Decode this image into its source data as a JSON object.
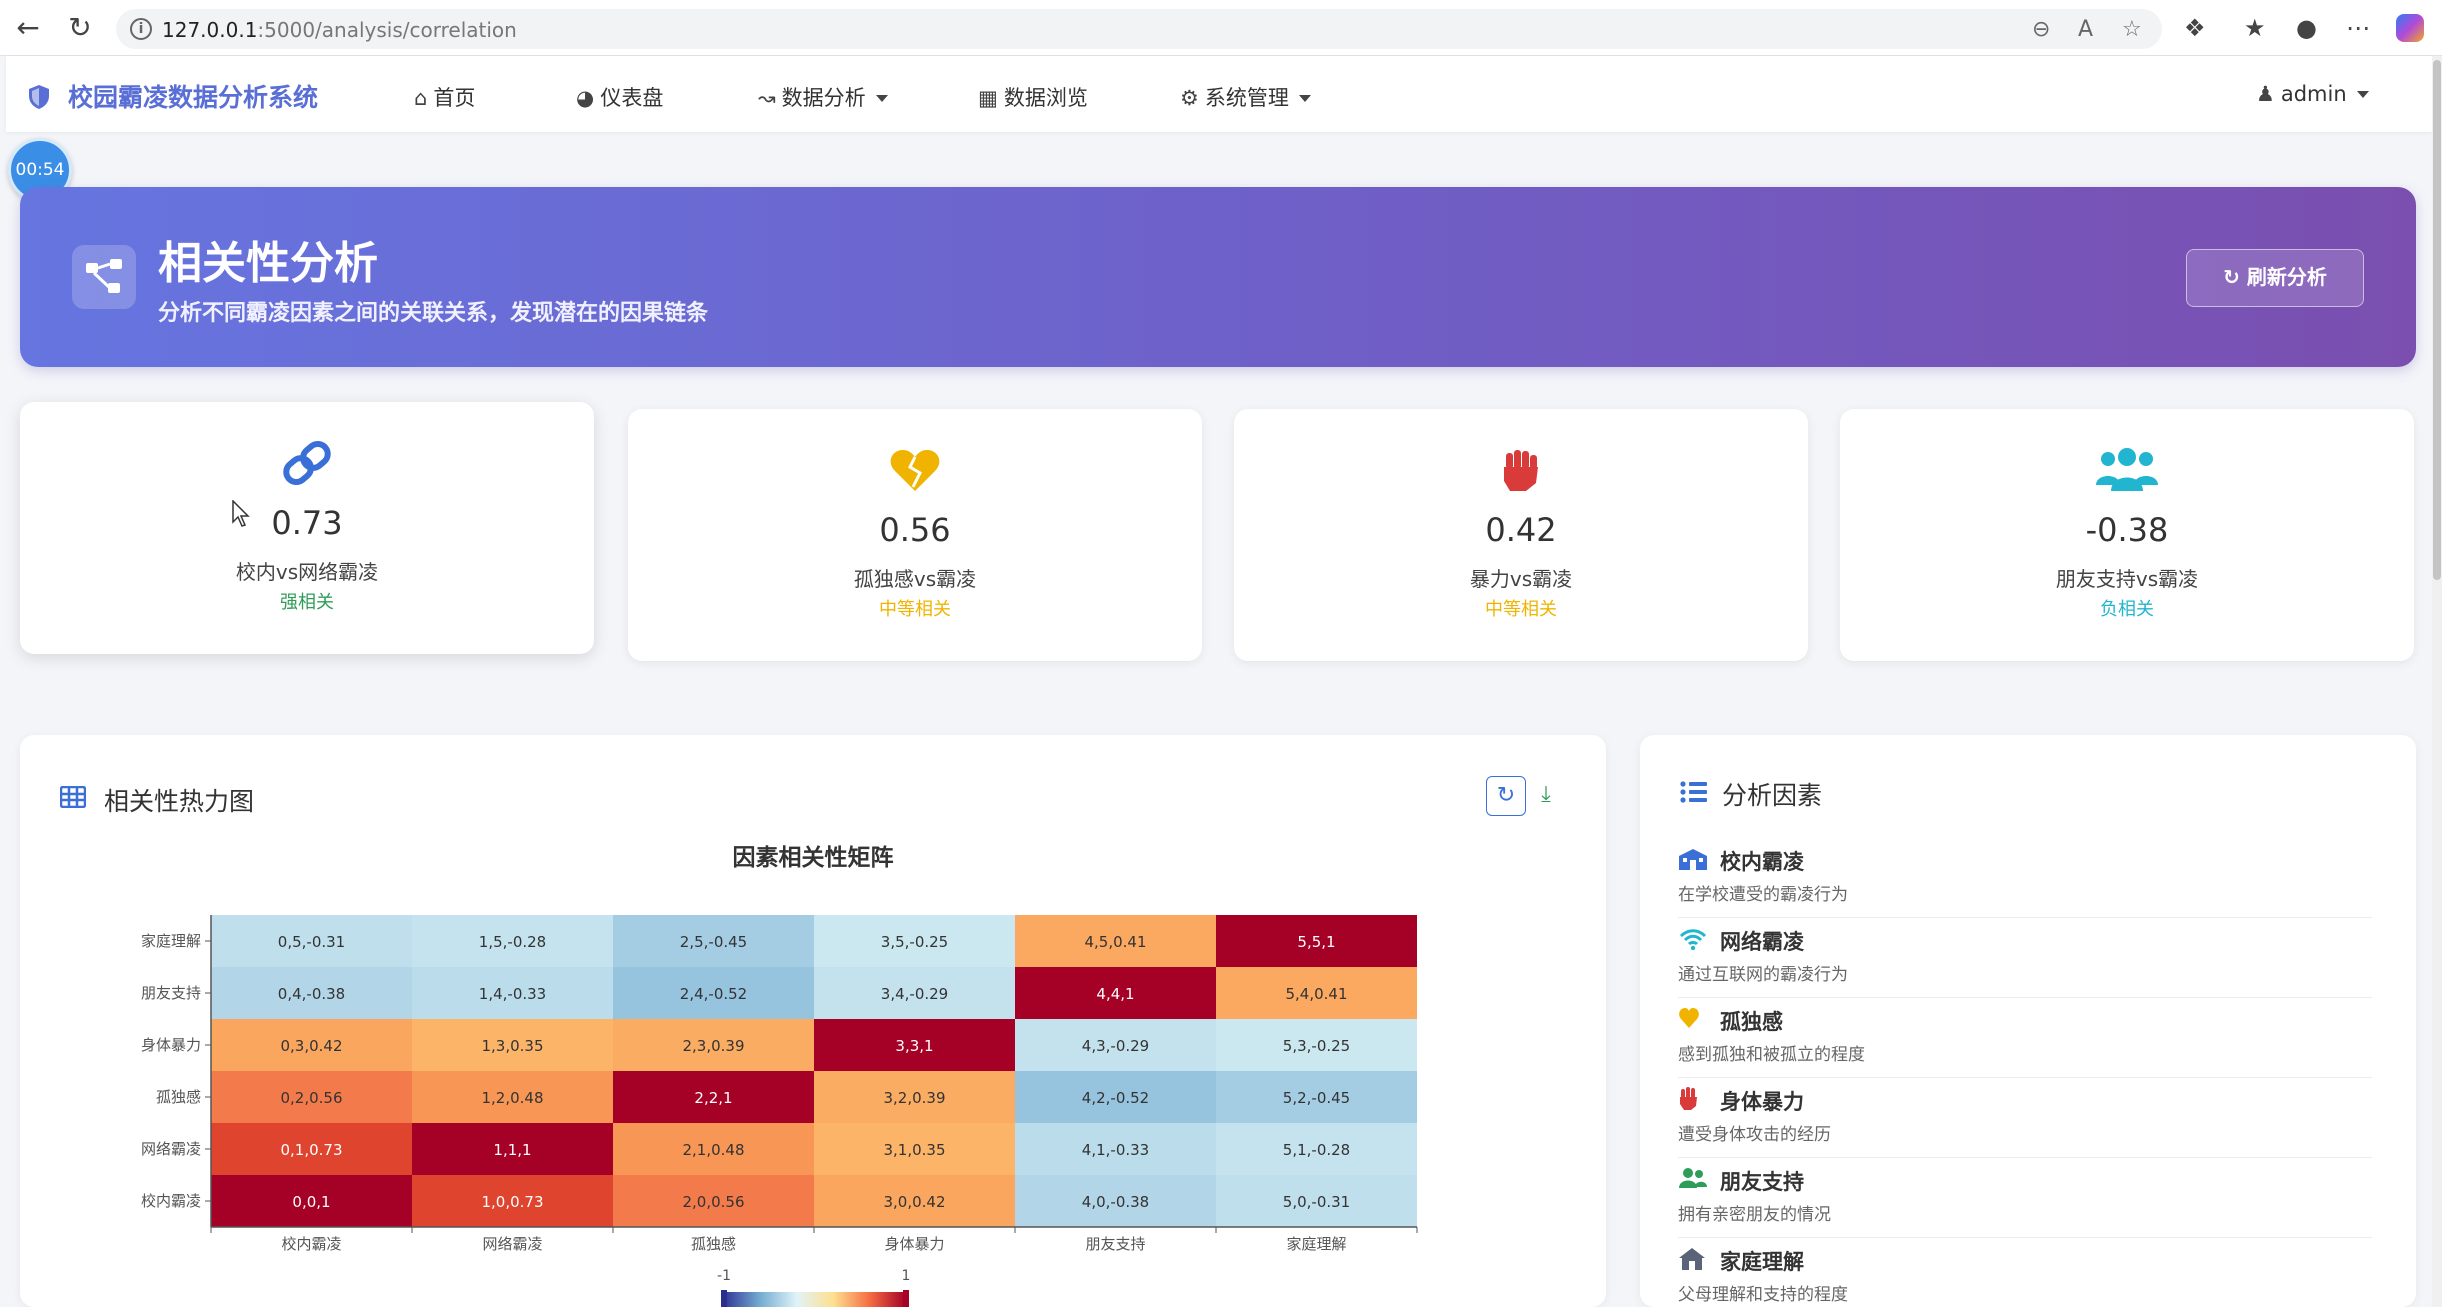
{
  "browser": {
    "url_host": "127.0.0.1",
    "url_rest": ":5000/analysis/correlation"
  },
  "navbar": {
    "brand": "校园霸凌数据分析系统",
    "items": [
      {
        "label": "首页"
      },
      {
        "label": "仪表盘"
      },
      {
        "label": "数据分析"
      },
      {
        "label": "数据浏览"
      },
      {
        "label": "系统管理"
      }
    ],
    "user": "admin"
  },
  "timer": "00:54",
  "hero": {
    "title": "相关性分析",
    "subtitle": "分析不同霸凌因素之间的关联关系，发现潜在的因果链条",
    "refresh_label": "刷新分析"
  },
  "stats": [
    {
      "value": "0.73",
      "label": "校内vs网络霸凌",
      "level": "强相关",
      "color": "#2e9d57"
    },
    {
      "value": "0.56",
      "label": "孤独感vs霸凌",
      "level": "中等相关",
      "color": "#f0b400"
    },
    {
      "value": "0.42",
      "label": "暴力vs霸凌",
      "level": "中等相关",
      "color": "#f0b400"
    },
    {
      "value": "-0.38",
      "label": "朋友支持vs霸凌",
      "level": "负相关",
      "color": "#22b5cf"
    }
  ],
  "heatmap_card": {
    "title": "相关性热力图"
  },
  "chart_data": {
    "type": "heatmap",
    "title": "因素相关性矩阵",
    "x_labels": [
      "校内霸凌",
      "网络霸凌",
      "孤独感",
      "身体暴力",
      "朋友支持",
      "家庭理解"
    ],
    "y_labels": [
      "校内霸凌",
      "网络霸凌",
      "孤独感",
      "身体暴力",
      "朋友支持",
      "家庭理解"
    ],
    "matrix": [
      [
        1,
        0.73,
        0.56,
        0.42,
        -0.38,
        -0.31
      ],
      [
        0.73,
        1,
        0.48,
        0.35,
        -0.33,
        -0.28
      ],
      [
        0.56,
        0.48,
        1,
        0.39,
        -0.52,
        -0.45
      ],
      [
        0.42,
        0.35,
        0.39,
        1,
        -0.29,
        -0.25
      ],
      [
        -0.38,
        -0.33,
        -0.52,
        -0.29,
        1,
        0.41
      ],
      [
        -0.31,
        -0.28,
        -0.45,
        -0.25,
        0.41,
        1
      ]
    ],
    "cell_labels": [
      [
        "0,0,1",
        "1,0,0.73",
        "2,0,0.56",
        "3,0,0.42",
        "4,0,-0.38",
        "5,0,-0.31"
      ],
      [
        "0,1,0.73",
        "1,1,1",
        "2,1,0.48",
        "3,1,0.35",
        "4,1,-0.33",
        "5,1,-0.28"
      ],
      [
        "0,2,0.56",
        "1,2,0.48",
        "2,2,1",
        "3,2,0.39",
        "4,2,-0.52",
        "5,2,-0.45"
      ],
      [
        "0,3,0.42",
        "1,3,0.35",
        "2,3,0.39",
        "3,3,1",
        "4,3,-0.29",
        "5,3,-0.25"
      ],
      [
        "0,4,-0.38",
        "1,4,-0.33",
        "2,4,-0.52",
        "3,4,-0.29",
        "4,4,1",
        "5,4,0.41"
      ],
      [
        "0,5,-0.31",
        "1,5,-0.28",
        "2,5,-0.45",
        "3,5,-0.25",
        "4,5,0.41",
        "5,5,1"
      ]
    ],
    "range": [
      -1,
      1
    ],
    "range_labels": [
      "-1",
      "1"
    ]
  },
  "factors_card": {
    "title": "分析因素",
    "items": [
      {
        "name": "校内霸凌",
        "desc": "在学校遭受的霸凌行为",
        "icon": "school-icon",
        "color": "#3a6fd8"
      },
      {
        "name": "网络霸凌",
        "desc": "通过互联网的霸凌行为",
        "icon": "wifi-icon",
        "color": "#22b5cf"
      },
      {
        "name": "孤独感",
        "desc": "感到孤独和被孤立的程度",
        "icon": "heart-broken-icon",
        "color": "#f0b400"
      },
      {
        "name": "身体暴力",
        "desc": "遭受身体攻击的经历",
        "icon": "fist-icon",
        "color": "#d93a3a"
      },
      {
        "name": "朋友支持",
        "desc": "拥有亲密朋友的情况",
        "icon": "users-icon",
        "color": "#2e9d57"
      },
      {
        "name": "家庭理解",
        "desc": "父母理解和支持的程度",
        "icon": "home-icon",
        "color": "#5a6478"
      }
    ]
  }
}
